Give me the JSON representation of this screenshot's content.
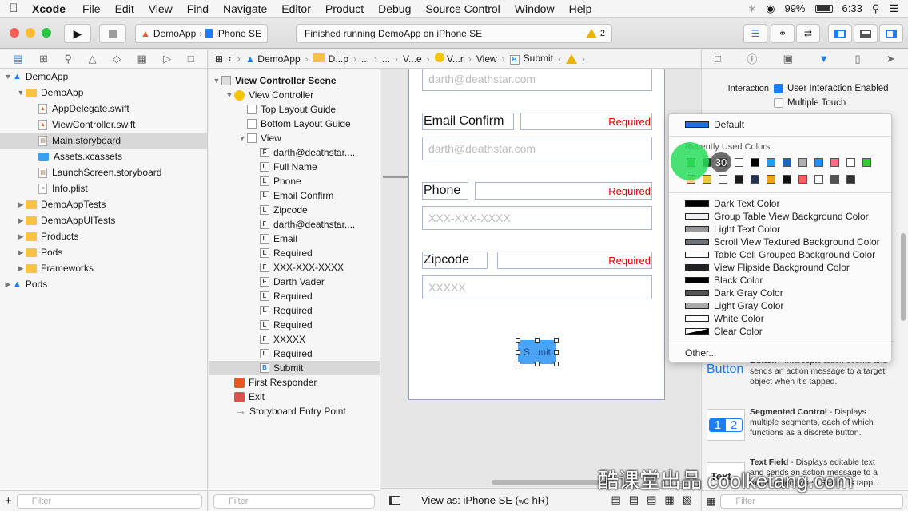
{
  "menubar": {
    "app": "Xcode",
    "items": [
      "File",
      "Edit",
      "View",
      "Find",
      "Navigate",
      "Editor",
      "Product",
      "Debug",
      "Source Control",
      "Window",
      "Help"
    ],
    "battery": "99%",
    "time": "6:33"
  },
  "toolbar": {
    "scheme_app": "DemoApp",
    "scheme_device": "iPhone SE",
    "activity": "Finished running DemoApp on iPhone SE",
    "warnings": "2"
  },
  "navigator": {
    "rows": [
      {
        "label": "DemoApp",
        "indent": 0,
        "type": "project",
        "disc": "▼"
      },
      {
        "label": "DemoApp",
        "indent": 1,
        "type": "folder",
        "disc": "▼"
      },
      {
        "label": "AppDelegate.swift",
        "indent": 2,
        "type": "swift",
        "disc": ""
      },
      {
        "label": "ViewController.swift",
        "indent": 2,
        "type": "swift",
        "disc": ""
      },
      {
        "label": "Main.storyboard",
        "indent": 2,
        "type": "storyboard",
        "disc": "",
        "selected": true
      },
      {
        "label": "Assets.xcassets",
        "indent": 2,
        "type": "assets",
        "disc": ""
      },
      {
        "label": "LaunchScreen.storyboard",
        "indent": 2,
        "type": "storyboard",
        "disc": ""
      },
      {
        "label": "Info.plist",
        "indent": 2,
        "type": "plist",
        "disc": ""
      },
      {
        "label": "DemoAppTests",
        "indent": 1,
        "type": "folder",
        "disc": "▶"
      },
      {
        "label": "DemoAppUITests",
        "indent": 1,
        "type": "folder",
        "disc": "▶"
      },
      {
        "label": "Products",
        "indent": 1,
        "type": "folder",
        "disc": "▶"
      },
      {
        "label": "Pods",
        "indent": 1,
        "type": "folder",
        "disc": "▶"
      },
      {
        "label": "Frameworks",
        "indent": 1,
        "type": "folder",
        "disc": "▶"
      },
      {
        "label": "Pods",
        "indent": 0,
        "type": "project",
        "disc": "▶"
      }
    ],
    "filter_placeholder": "Filter"
  },
  "jumpbar": {
    "items": [
      "DemoApp",
      "D...p",
      "...",
      "...",
      "V...e",
      "V...r",
      "View",
      "Submit"
    ]
  },
  "outline": {
    "rows": [
      {
        "label": "View Controller Scene",
        "indent": 0,
        "icon": "scene",
        "disc": "▼",
        "bold": true
      },
      {
        "label": "View Controller",
        "indent": 1,
        "icon": "vc",
        "disc": "▼"
      },
      {
        "label": "Top Layout Guide",
        "indent": 2,
        "icon": "guide",
        "disc": ""
      },
      {
        "label": "Bottom Layout Guide",
        "indent": 2,
        "icon": "guide",
        "disc": ""
      },
      {
        "label": "View",
        "indent": 2,
        "icon": "view",
        "disc": "▼"
      },
      {
        "label": "darth@deathstar....",
        "indent": 3,
        "icon": "F",
        "disc": ""
      },
      {
        "label": "Full Name",
        "indent": 3,
        "icon": "L",
        "disc": ""
      },
      {
        "label": "Phone",
        "indent": 3,
        "icon": "L",
        "disc": ""
      },
      {
        "label": "Email Confirm",
        "indent": 3,
        "icon": "L",
        "disc": ""
      },
      {
        "label": "Zipcode",
        "indent": 3,
        "icon": "L",
        "disc": ""
      },
      {
        "label": "darth@deathstar....",
        "indent": 3,
        "icon": "F",
        "disc": ""
      },
      {
        "label": "Email",
        "indent": 3,
        "icon": "L",
        "disc": ""
      },
      {
        "label": "Required",
        "indent": 3,
        "icon": "L",
        "disc": ""
      },
      {
        "label": "XXX-XXX-XXXX",
        "indent": 3,
        "icon": "F",
        "disc": ""
      },
      {
        "label": "Darth Vader",
        "indent": 3,
        "icon": "F",
        "disc": ""
      },
      {
        "label": "Required",
        "indent": 3,
        "icon": "L",
        "disc": ""
      },
      {
        "label": "Required",
        "indent": 3,
        "icon": "L",
        "disc": ""
      },
      {
        "label": "Required",
        "indent": 3,
        "icon": "L",
        "disc": ""
      },
      {
        "label": "XXXXX",
        "indent": 3,
        "icon": "F",
        "disc": ""
      },
      {
        "label": "Required",
        "indent": 3,
        "icon": "L",
        "disc": ""
      },
      {
        "label": "Submit",
        "indent": 3,
        "icon": "B",
        "disc": "",
        "selected": true
      },
      {
        "label": "First Responder",
        "indent": 1,
        "icon": "responder",
        "disc": ""
      },
      {
        "label": "Exit",
        "indent": 1,
        "icon": "exit",
        "disc": ""
      },
      {
        "label": "Storyboard Entry Point",
        "indent": 1,
        "icon": "arrow",
        "disc": ""
      }
    ],
    "filter_placeholder": "Filter"
  },
  "form": {
    "email_placeholder": "darth@deathstar.com",
    "email_confirm_label": "Email Confirm",
    "required": "Required",
    "phone_label": "Phone",
    "phone_placeholder": "XXX-XXX-XXXX",
    "zip_label": "Zipcode",
    "zip_placeholder": "XXXXX",
    "submit": "S...mit"
  },
  "canvasbar": {
    "view_as": "View as: iPhone SE (",
    "wc": "wC",
    "hr": "hR)"
  },
  "inspector": {
    "interaction_label": "Interaction",
    "user_interaction": "User Interaction Enabled",
    "multiple_touch": "Multiple Touch",
    "library": [
      {
        "icon_text": "Button",
        "title": "Button",
        "desc": " - Intercepts touch events and sends an action message to a target object when it's tapped."
      },
      {
        "icon_text": "1 2",
        "title": "Segmented Control",
        "desc": " - Displays multiple segments, each of which functions as a discrete button."
      },
      {
        "icon_text": "Text",
        "title": "Text Field",
        "desc": " - Displays editable text and sends an action message to a target object when Return is tapp..."
      }
    ],
    "filter_placeholder": "Filter"
  },
  "color_popup": {
    "default": "Default",
    "recent_header": "Recently Used Colors",
    "cursor_badge": "30",
    "recent_colors": [
      "#2fbf3b",
      "#1f3b1f",
      "#111111",
      "#ffffff",
      "#000000",
      "#1ea0f0",
      "#2364b8",
      "#b0b0b0",
      "#1e90ff",
      "#ff6b81",
      "#ffffff",
      "#33cc33",
      "#f5d27a",
      "#f5c842",
      "#ffffff",
      "#1a1a1a",
      "#223355",
      "#e6a817",
      "#111111",
      "#ff5c5c",
      "#ffffff",
      "#555555",
      "#333333"
    ],
    "named": [
      {
        "label": "Dark Text Color",
        "color": "#000000"
      },
      {
        "label": "Group Table View Background Color",
        "color": "#efeff4"
      },
      {
        "label": "Light Text Color",
        "color": "#999999"
      },
      {
        "label": "Scroll View Textured Background Color",
        "color": "#6f7179"
      },
      {
        "label": "Table Cell Grouped Background Color",
        "color": "#ffffff"
      },
      {
        "label": "View Flipside Background Color",
        "color": "#1f2124"
      },
      {
        "label": "Black Color",
        "color": "#000000"
      },
      {
        "label": "Dark Gray Color",
        "color": "#555555"
      },
      {
        "label": "Light Gray Color",
        "color": "#aaaaaa"
      },
      {
        "label": "White Color",
        "color": "#ffffff"
      },
      {
        "label": "Clear Color",
        "color": "transparent"
      }
    ],
    "other": "Other..."
  },
  "watermark": "酷课堂出品 coolketang.com"
}
